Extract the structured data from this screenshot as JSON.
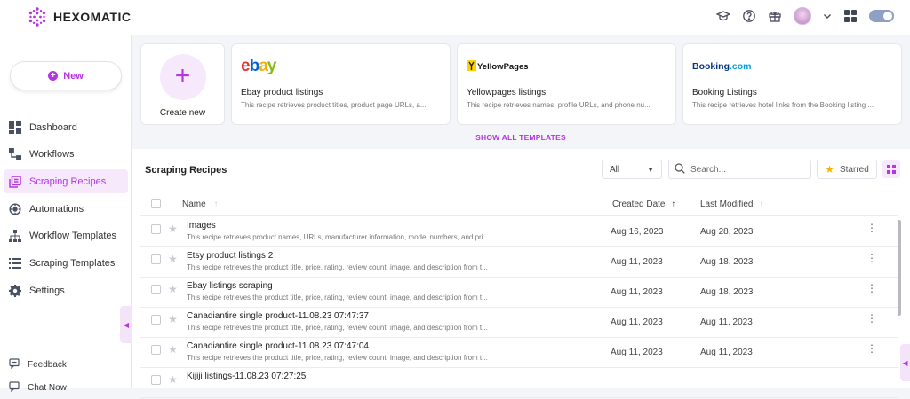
{
  "brand": {
    "name": "HEXOMATIC",
    "accent": "#b535e0"
  },
  "topbar": {
    "icons": [
      "graduation-cap-icon",
      "help-circle-icon",
      "gift-icon",
      "avatar",
      "chevron-down-icon",
      "apps-grid-icon",
      "theme-toggle"
    ]
  },
  "sidebar": {
    "new_label": "New",
    "items": [
      {
        "label": "Dashboard",
        "icon": "dashboard-icon",
        "active": false
      },
      {
        "label": "Workflows",
        "icon": "workflow-icon",
        "active": false
      },
      {
        "label": "Scraping Recipes",
        "icon": "recipe-icon",
        "active": true
      },
      {
        "label": "Automations",
        "icon": "automation-icon",
        "active": false
      },
      {
        "label": "Workflow Templates",
        "icon": "hierarchy-icon",
        "active": false
      },
      {
        "label": "Scraping Templates",
        "icon": "list-icon",
        "active": false
      },
      {
        "label": "Settings",
        "icon": "gear-icon",
        "active": false
      }
    ],
    "feedback_label": "Feedback",
    "chat_label": "Chat Now"
  },
  "templates": {
    "create_label": "Create new",
    "cards": [
      {
        "title": "Ebay product listings",
        "desc": "This recipe retrieves product titles, product page URLs, a...",
        "logo": "ebay"
      },
      {
        "title": "Yellowpages listings",
        "desc": "This recipe retrieves names, profile URLs, and phone nu...",
        "logo": "YellowPages"
      },
      {
        "title": "Booking Listings",
        "desc": "This recipe retrieves hotel links from the Booking listing ...",
        "logo": "Booking.com"
      }
    ],
    "show_all_label": "SHOW ALL TEMPLATES"
  },
  "recipes": {
    "title": "Scraping Recipes",
    "filter_value": "All",
    "search_placeholder": "Search...",
    "starred_label": "Starred",
    "columns": {
      "name": "Name",
      "created": "Created Date",
      "modified": "Last Modified"
    },
    "rows": [
      {
        "name": "Images",
        "desc": "This recipe retrieves product names, URLs, manufacturer information, model numbers, and pri...",
        "created": "Aug 16, 2023",
        "modified": "Aug 28, 2023"
      },
      {
        "name": "Etsy product listings 2",
        "desc": "This recipe retrieves the product title, price, rating, review count, image, and description from t...",
        "created": "Aug 11, 2023",
        "modified": "Aug 18, 2023"
      },
      {
        "name": "Ebay listings scraping",
        "desc": "This recipe retrieves the product title, price, rating, review count, image, and description from t...",
        "created": "Aug 11, 2023",
        "modified": "Aug 18, 2023"
      },
      {
        "name": "Canadiantire single product-11.08.23 07:47:37",
        "desc": "This recipe retrieves the product title, price, rating, review count, image, and description from t...",
        "created": "Aug 11, 2023",
        "modified": "Aug 11, 2023"
      },
      {
        "name": "Canadiantire single product-11.08.23 07:47:04",
        "desc": "This recipe retrieves the product title, price, rating, review count, image, and description from t...",
        "created": "Aug 11, 2023",
        "modified": "Aug 11, 2023"
      },
      {
        "name": "Kijiji listings-11.08.23 07:27:25",
        "desc": "",
        "created": "",
        "modified": ""
      }
    ]
  }
}
